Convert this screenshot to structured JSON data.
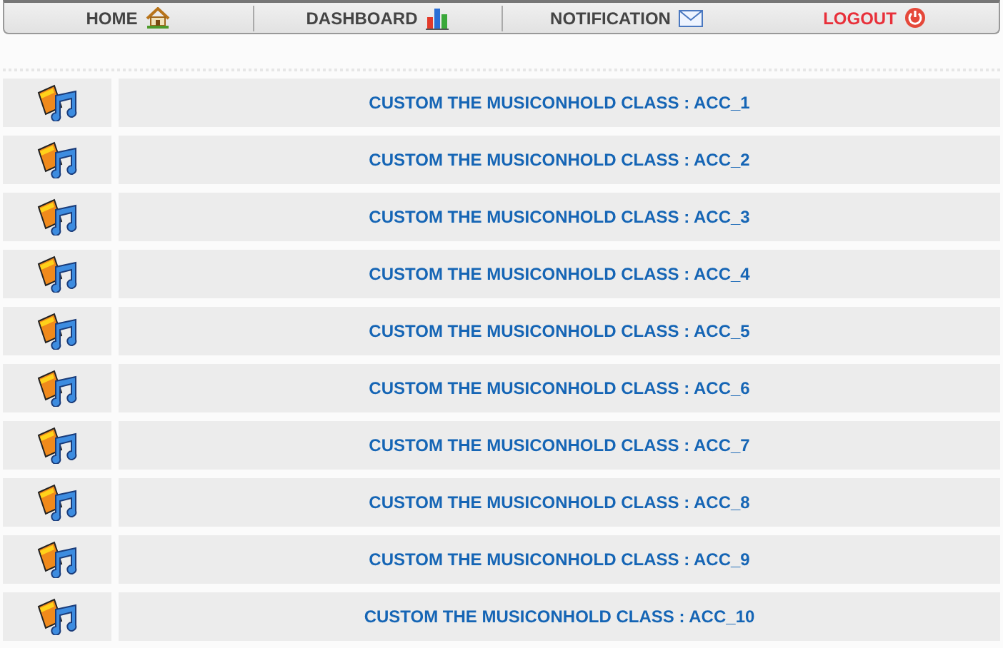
{
  "nav": [
    {
      "label": "HOME",
      "kind": "normal"
    },
    {
      "label": "DASHBOARD",
      "kind": "normal"
    },
    {
      "label": "NOTIFICATION",
      "kind": "normal"
    },
    {
      "label": "LOGOUT",
      "kind": "danger"
    }
  ],
  "rows": [
    {
      "label": "CUSTOM THE MUSICONHOLD CLASS : ACC_1"
    },
    {
      "label": "CUSTOM THE MUSICONHOLD CLASS : ACC_2"
    },
    {
      "label": "CUSTOM THE MUSICONHOLD CLASS : ACC_3"
    },
    {
      "label": "CUSTOM THE MUSICONHOLD CLASS : ACC_4"
    },
    {
      "label": "CUSTOM THE MUSICONHOLD CLASS : ACC_5"
    },
    {
      "label": "CUSTOM THE MUSICONHOLD CLASS : ACC_6"
    },
    {
      "label": "CUSTOM THE MUSICONHOLD CLASS : ACC_7"
    },
    {
      "label": "CUSTOM THE MUSICONHOLD CLASS : ACC_8"
    },
    {
      "label": "CUSTOM THE MUSICONHOLD CLASS : ACC_9"
    },
    {
      "label": "CUSTOM THE MUSICONHOLD CLASS : ACC_10"
    }
  ]
}
